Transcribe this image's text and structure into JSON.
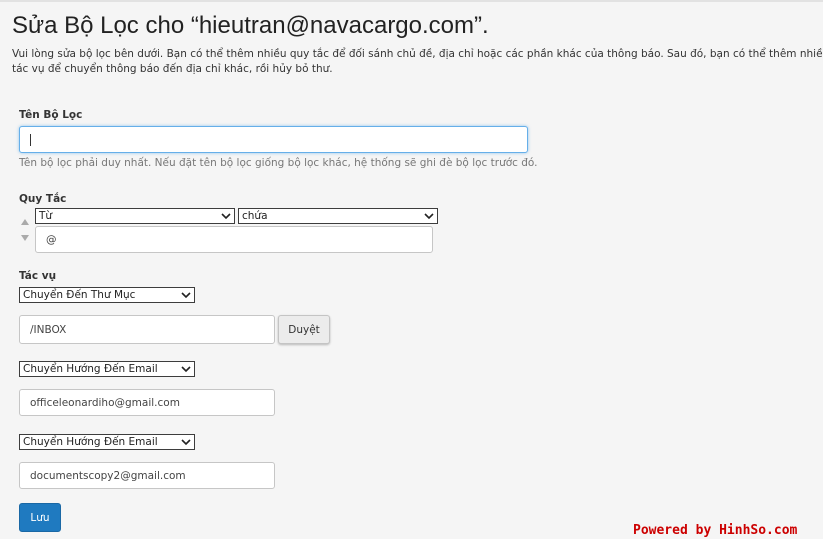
{
  "page": {
    "title": "Sửa Bộ Lọc cho “hieutran@navacargo.com”.",
    "description": "Vui lòng sửa bộ lọc bên dưới. Bạn có thể thêm nhiều quy tắc để đối sánh chủ đề, địa chỉ hoặc các phần khác của thông báo. Sau đó, bạn có thể thêm nhiều tác vụ để chuyển thông báo đến địa chỉ khác, rồi hủy bỏ thư."
  },
  "filter_name": {
    "label": "Tên Bộ Lọc",
    "value": "",
    "help": "Tên bộ lọc phải duy nhất. Nếu đặt tên bộ lọc giống bộ lọc khác, hệ thống sẽ ghi đè bộ lọc trước đó."
  },
  "rules": {
    "label": "Quy Tắc",
    "field_select": "Từ",
    "operator_select": "chứa",
    "value": "@"
  },
  "actions": {
    "label": "Tác vụ",
    "items": [
      {
        "select": "Chuyển Đến Thư Mục",
        "value": "/INBOX"
      },
      {
        "select": "Chuyển Hướng Đến Email",
        "value": "officeleonardiho@gmail.com"
      },
      {
        "select": "Chuyển Hướng Đến Email",
        "value": "documentscopy2@gmail.com"
      }
    ],
    "browse_label": "Duyệt"
  },
  "save_label": "Lưu",
  "watermark": "Powered by HinhSo.com"
}
